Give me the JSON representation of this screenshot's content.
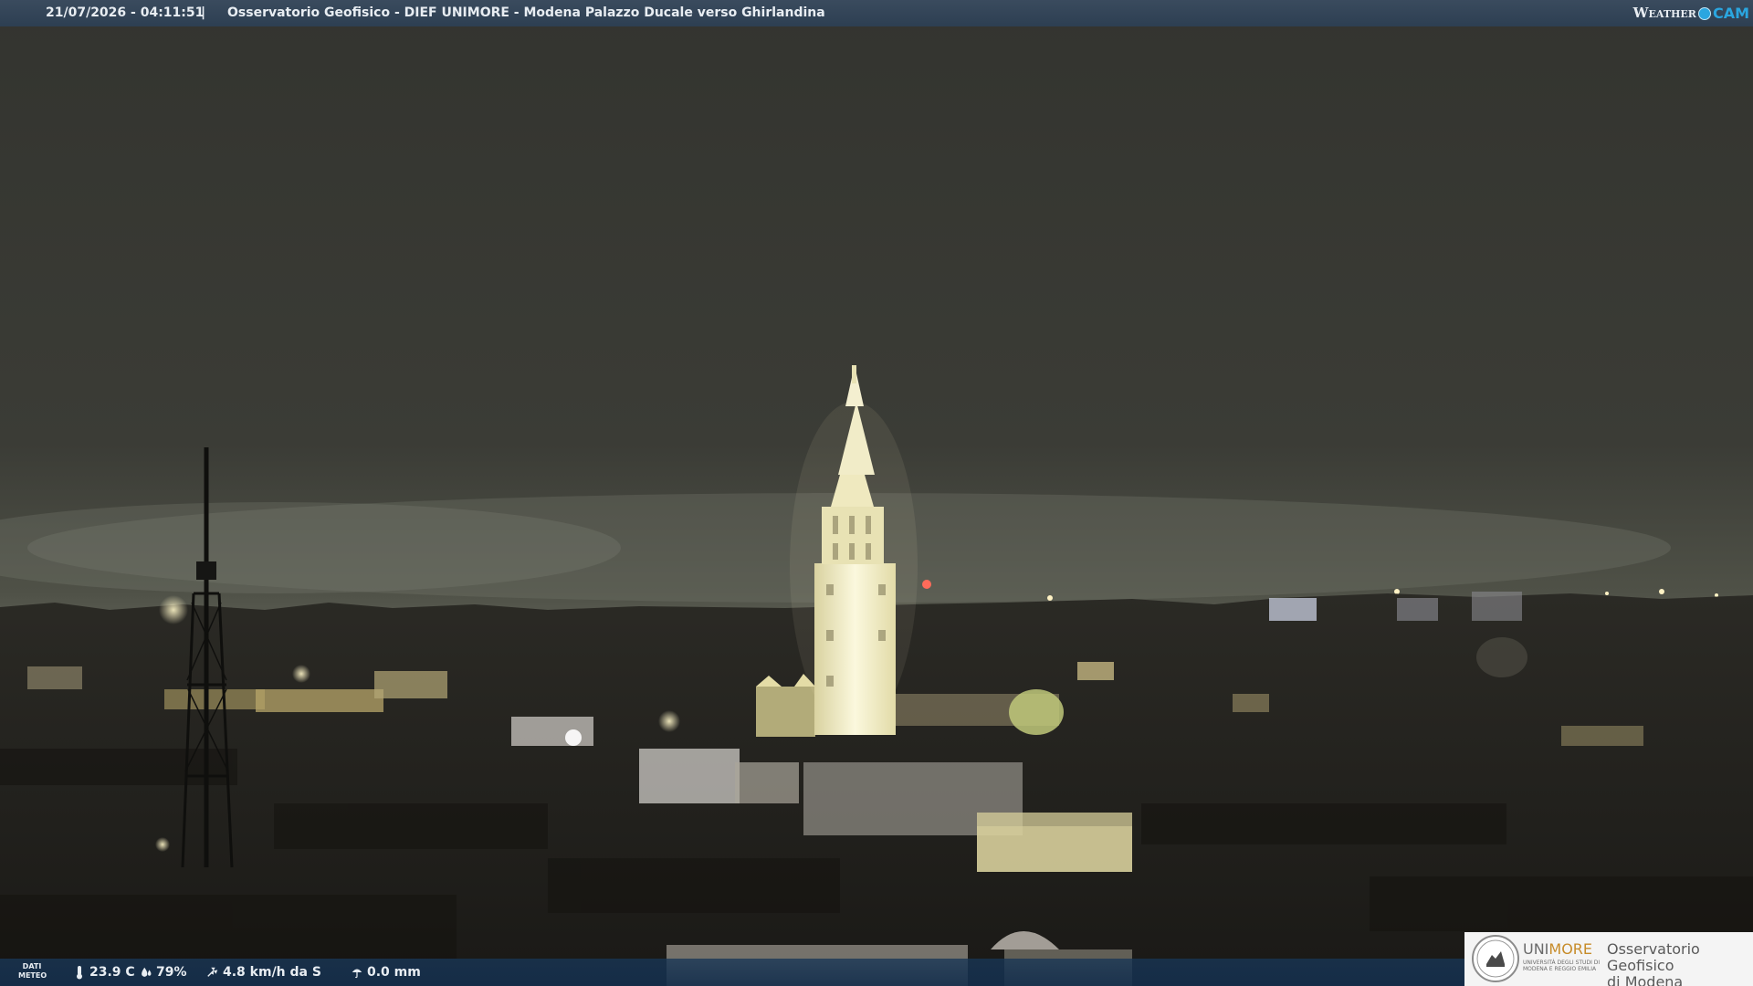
{
  "header": {
    "timestamp": "21/07/2026 - 04:11:51",
    "separator": "|",
    "title": "Osservatorio Geofisico - DIEF UNIMORE - Modena Palazzo Ducale verso Ghirlandina"
  },
  "brand": {
    "weather": "Weather",
    "cam": "CAM"
  },
  "weather": {
    "label_line1": "DATI",
    "label_line2": "METEO",
    "temperature": "23.9 C",
    "humidity": "79%",
    "wind": "4.8 km/h da S",
    "rain": "0.0 mm",
    "icons": [
      "thermometer-icon",
      "humidity-drop-icon",
      "wind-icon",
      "rain-umbrella-icon"
    ]
  },
  "logo": {
    "uni_primary": "UNI",
    "uni_accent": "MORE",
    "uni_sub_line1": "UNIVERSITÀ DEGLI STUDI DI",
    "uni_sub_line2": "MODENA E REGGIO EMILIA",
    "observatory_line1": "Osservatorio Geofisico",
    "observatory_line2": "di Modena"
  },
  "colors": {
    "topbar": "#2d3f52",
    "bottombar": "#1a3a5c",
    "accent_blue": "#2aa6e0",
    "unimore_gold": "#c78c2a",
    "sky": "#3a3b35",
    "tower_light": "#f3f0cc"
  }
}
